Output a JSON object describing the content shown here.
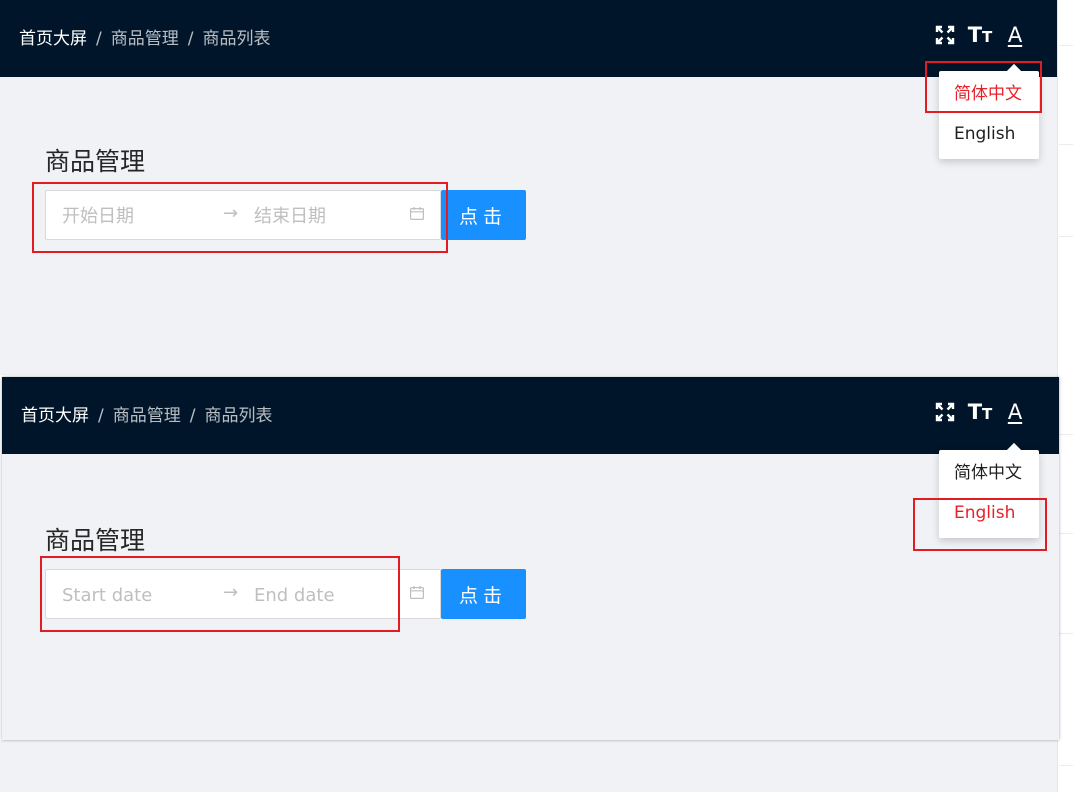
{
  "colors": {
    "header_bg": "#001529",
    "content_bg": "#f0f2f5",
    "primary_button": "#1890ff",
    "active_language": "#e8202a",
    "annotation_box": "#e31c23"
  },
  "icons": {
    "fullscreen": "fullscreen-icon",
    "font_size": "font-size-icon",
    "language": "language-icon",
    "calendar": "calendar-icon",
    "range_arrow": "arrow-right-icon"
  },
  "panel_zh": {
    "breadcrumb": {
      "home": "首页大屏",
      "sep1": "/",
      "level2": "商品管理",
      "sep2": "/",
      "level3": "商品列表"
    },
    "toolbar": {
      "font_size_big": "T",
      "font_size_small": "T",
      "language_glyph": "A"
    },
    "language_menu": {
      "items": [
        {
          "label": "简体中文",
          "active": true
        },
        {
          "label": "English",
          "active": false
        }
      ]
    },
    "section_title": "商品管理",
    "date_range": {
      "start_placeholder": "开始日期",
      "separator": "→",
      "end_placeholder": "结束日期"
    },
    "submit_label": "点击"
  },
  "panel_en": {
    "breadcrumb": {
      "home": "首页大屏",
      "sep1": "/",
      "level2": "商品管理",
      "sep2": "/",
      "level3": "商品列表"
    },
    "toolbar": {
      "font_size_big": "T",
      "font_size_small": "T",
      "language_glyph": "A"
    },
    "language_menu": {
      "items": [
        {
          "label": "简体中文",
          "active": false
        },
        {
          "label": "English",
          "active": true
        }
      ]
    },
    "section_title": "商品管理",
    "date_range": {
      "start_placeholder": "Start date",
      "separator": "→",
      "end_placeholder": "End date"
    },
    "submit_label": "点击"
  }
}
